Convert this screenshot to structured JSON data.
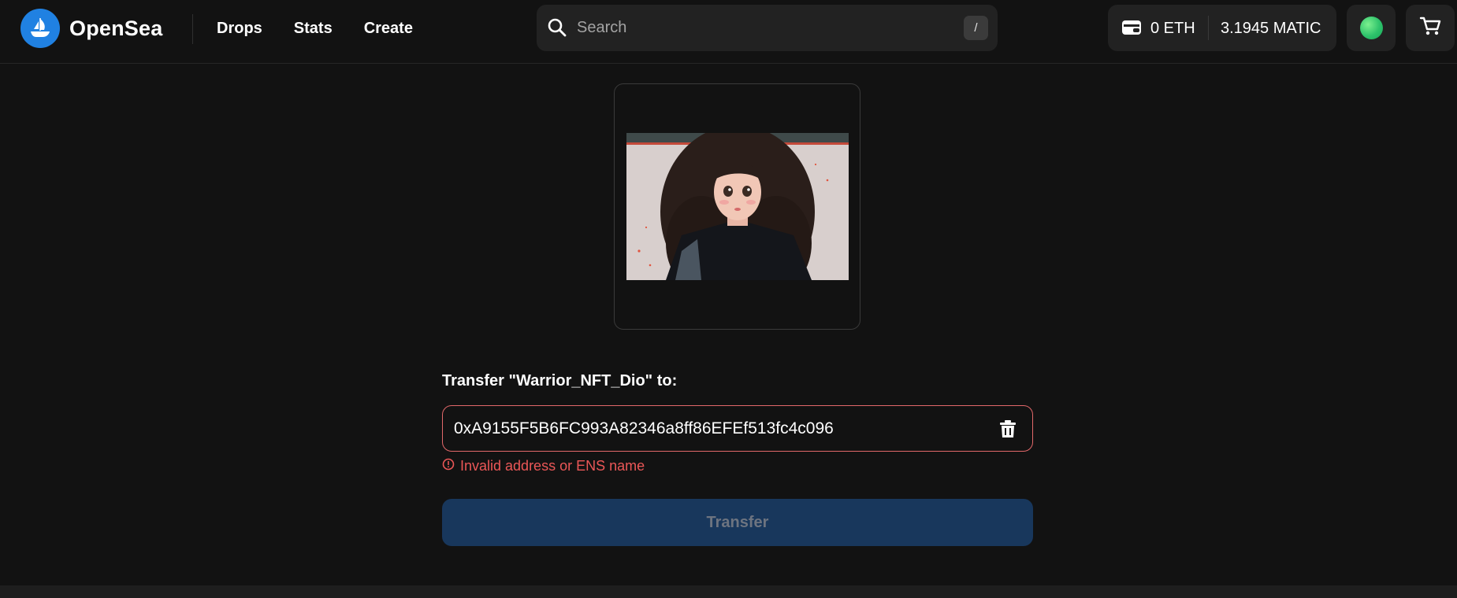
{
  "header": {
    "brand": "OpenSea",
    "nav": [
      {
        "label": "Drops"
      },
      {
        "label": "Stats"
      },
      {
        "label": "Create"
      }
    ],
    "search": {
      "placeholder": "Search",
      "shortcut": "/"
    },
    "wallet": {
      "eth": "0 ETH",
      "matic": "3.1945 MATIC"
    }
  },
  "transfer": {
    "label": "Transfer \"Warrior_NFT_Dio\" to:",
    "address_value": "0xA9155F5B6FC993A82346a8ff86EFEf513fc4c096",
    "error": "Invalid address or ENS name",
    "button_label": "Transfer"
  },
  "colors": {
    "background": "#121212",
    "brand_blue": "#2081e2",
    "error_red": "#eb5757",
    "disabled_button": "#18375c"
  },
  "icons": [
    "opensea-logo-icon",
    "search-icon",
    "wallet-icon",
    "cart-icon",
    "trash-icon",
    "error-circle-icon"
  ]
}
